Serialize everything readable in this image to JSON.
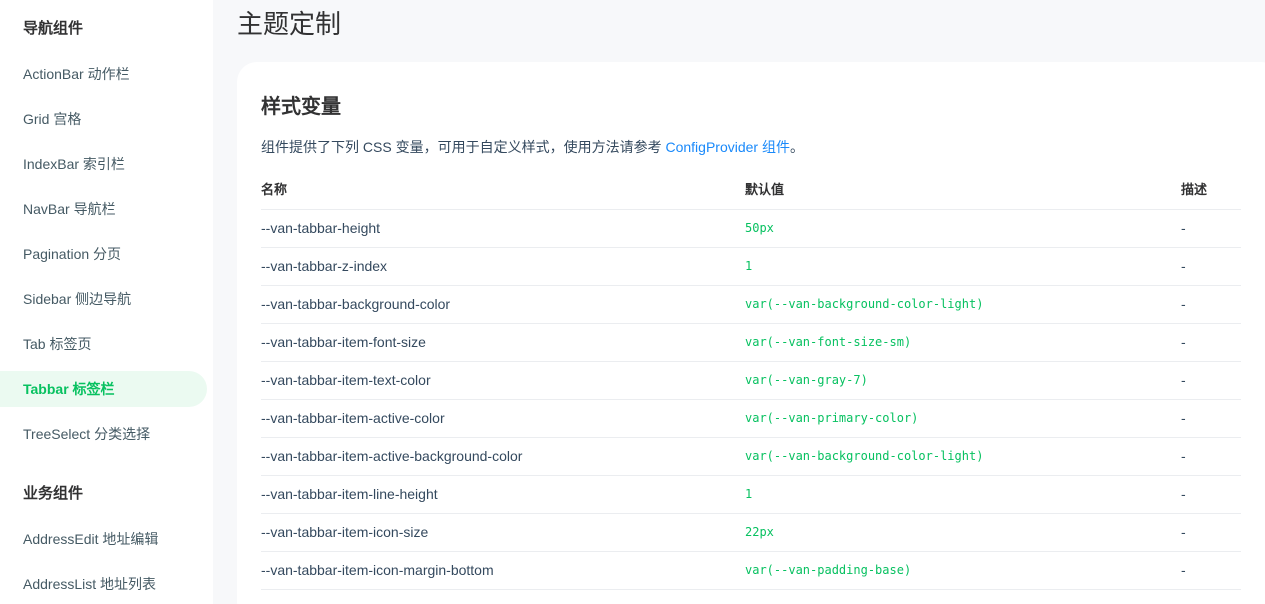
{
  "sidebar": {
    "group_nav": "导航组件",
    "group_biz": "业务组件",
    "items": [
      {
        "label": "ActionBar 动作栏"
      },
      {
        "label": "Grid 宫格"
      },
      {
        "label": "IndexBar 索引栏"
      },
      {
        "label": "NavBar 导航栏"
      },
      {
        "label": "Pagination 分页"
      },
      {
        "label": "Sidebar 侧边导航"
      },
      {
        "label": "Tab 标签页"
      },
      {
        "label": "Tabbar 标签栏"
      },
      {
        "label": "TreeSelect 分类选择"
      }
    ],
    "biz_items": [
      {
        "label": "AddressEdit 地址编辑"
      },
      {
        "label": "AddressList 地址列表"
      }
    ],
    "active_index": 7
  },
  "main": {
    "page_title": "主题定制",
    "section_title": "样式变量",
    "desc_prefix": "组件提供了下列 CSS 变量，可用于自定义样式，使用方法请参考 ",
    "desc_link": "ConfigProvider 组件",
    "desc_suffix": "。",
    "table": {
      "headers": [
        "名称",
        "默认值",
        "描述"
      ],
      "rows": [
        {
          "name": "--van-tabbar-height",
          "default": "50px",
          "desc": "-"
        },
        {
          "name": "--van-tabbar-z-index",
          "default": "1",
          "desc": "-"
        },
        {
          "name": "--van-tabbar-background-color",
          "default": "var(--van-background-color-light)",
          "desc": "-"
        },
        {
          "name": "--van-tabbar-item-font-size",
          "default": "var(--van-font-size-sm)",
          "desc": "-"
        },
        {
          "name": "--van-tabbar-item-text-color",
          "default": "var(--van-gray-7)",
          "desc": "-"
        },
        {
          "name": "--van-tabbar-item-active-color",
          "default": "var(--van-primary-color)",
          "desc": "-"
        },
        {
          "name": "--van-tabbar-item-active-background-color",
          "default": "var(--van-background-color-light)",
          "desc": "-"
        },
        {
          "name": "--van-tabbar-item-line-height",
          "default": "1",
          "desc": "-"
        },
        {
          "name": "--van-tabbar-item-icon-size",
          "default": "22px",
          "desc": "-"
        },
        {
          "name": "--van-tabbar-item-icon-margin-bottom",
          "default": "var(--van-padding-base)",
          "desc": "-"
        }
      ]
    }
  },
  "colors": {
    "accent": "#07c160",
    "link": "#1989fa",
    "active_bg": "#ebfaf1"
  }
}
